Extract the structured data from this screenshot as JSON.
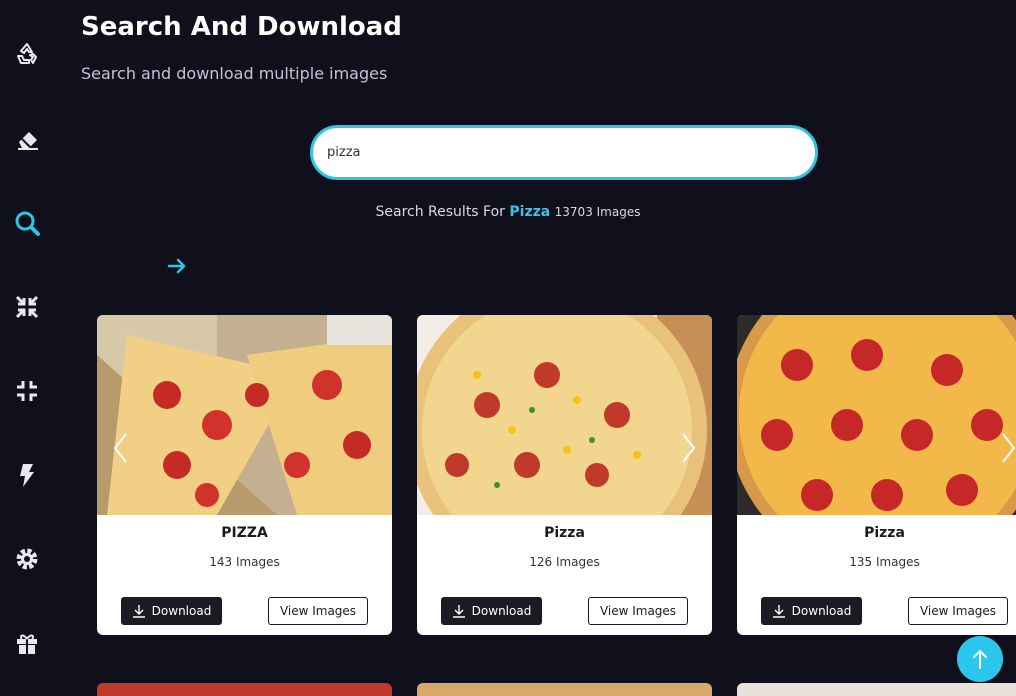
{
  "page": {
    "title": "Search And Download",
    "subtitle": "Search and download multiple images"
  },
  "sidebar": {
    "items": [
      {
        "icon": "recycle-icon"
      },
      {
        "icon": "eraser-icon"
      },
      {
        "icon": "search-icon",
        "active": true
      },
      {
        "icon": "compress-arrows-icon"
      },
      {
        "icon": "compress-icon"
      },
      {
        "icon": "bolt-icon"
      },
      {
        "icon": "gear-icon"
      },
      {
        "icon": "gift-icon"
      }
    ]
  },
  "search": {
    "value": "pizza",
    "results_prefix": "Search Results For",
    "keyword": "Pizza",
    "count": "13703 Images"
  },
  "cards": [
    {
      "name": "PIZZA",
      "count": "143 Images",
      "download": "Download",
      "view": "View Images"
    },
    {
      "name": "Pizza",
      "count": "126 Images",
      "download": "Download",
      "view": "View Images"
    },
    {
      "name": "Pizza",
      "count": "135 Images",
      "download": "Download",
      "view": "View Images"
    }
  ],
  "colors": {
    "background": "#10101d",
    "accent": "#2bc5e6"
  }
}
